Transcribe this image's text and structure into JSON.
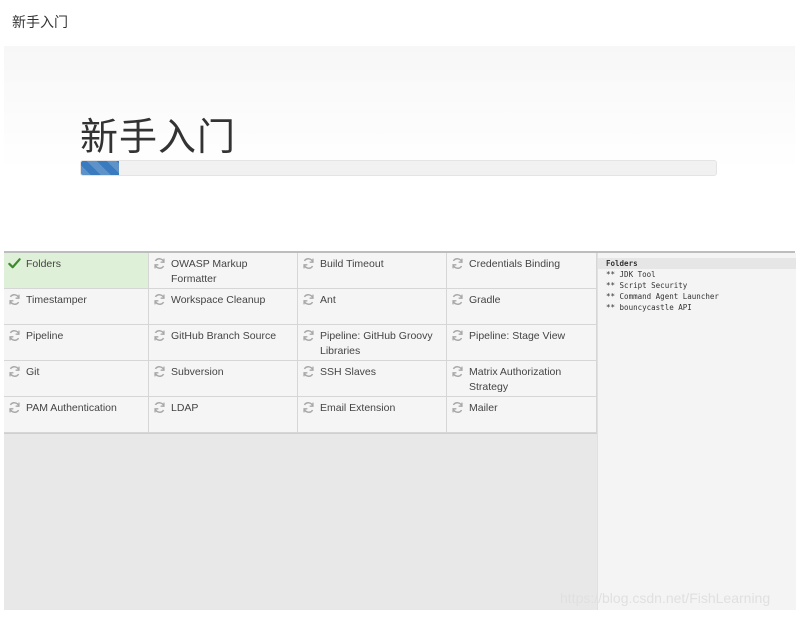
{
  "topbar": {
    "title": "新手入门"
  },
  "hero": {
    "title": "新手入门",
    "progress": 0.06
  },
  "plugins": [
    {
      "name": "Folders",
      "status": "success",
      "icon": "checkmark-icon"
    },
    {
      "name": "OWASP Markup Formatter",
      "status": "pending",
      "icon": "refresh-icon"
    },
    {
      "name": "Build Timeout",
      "status": "pending",
      "icon": "refresh-icon"
    },
    {
      "name": "Credentials Binding",
      "status": "pending",
      "icon": "refresh-icon"
    },
    {
      "name": "Timestamper",
      "status": "pending",
      "icon": "refresh-icon"
    },
    {
      "name": "Workspace Cleanup",
      "status": "pending",
      "icon": "refresh-icon"
    },
    {
      "name": "Ant",
      "status": "pending",
      "icon": "refresh-icon"
    },
    {
      "name": "Gradle",
      "status": "pending",
      "icon": "refresh-icon"
    },
    {
      "name": "Pipeline",
      "status": "pending",
      "icon": "refresh-icon"
    },
    {
      "name": "GitHub Branch Source",
      "status": "pending",
      "icon": "refresh-icon"
    },
    {
      "name": "Pipeline: GitHub Groovy Libraries",
      "status": "pending",
      "icon": "refresh-icon"
    },
    {
      "name": "Pipeline: Stage View",
      "status": "pending",
      "icon": "refresh-icon"
    },
    {
      "name": "Git",
      "status": "pending",
      "icon": "refresh-icon"
    },
    {
      "name": "Subversion",
      "status": "pending",
      "icon": "refresh-icon"
    },
    {
      "name": "SSH Slaves",
      "status": "pending",
      "icon": "refresh-icon"
    },
    {
      "name": "Matrix Authorization Strategy",
      "status": "pending",
      "icon": "refresh-icon"
    },
    {
      "name": "PAM Authentication",
      "status": "pending",
      "icon": "refresh-icon"
    },
    {
      "name": "LDAP",
      "status": "pending",
      "icon": "refresh-icon"
    },
    {
      "name": "Email Extension",
      "status": "pending",
      "icon": "refresh-icon"
    },
    {
      "name": "Mailer",
      "status": "pending",
      "icon": "refresh-icon"
    }
  ],
  "log": {
    "heading": "Folders",
    "lines": "** JDK Tool\n** Script Security\n** Command Agent Launcher\n** bouncycastle API"
  },
  "watermark": "https://blog.csdn.net/FishLearning",
  "colors": {
    "progress": "#3a7bbf",
    "success_bg": "#dff0d8",
    "success_icon": "#3c8a2e",
    "pending_icon": "#a8a8a8"
  }
}
